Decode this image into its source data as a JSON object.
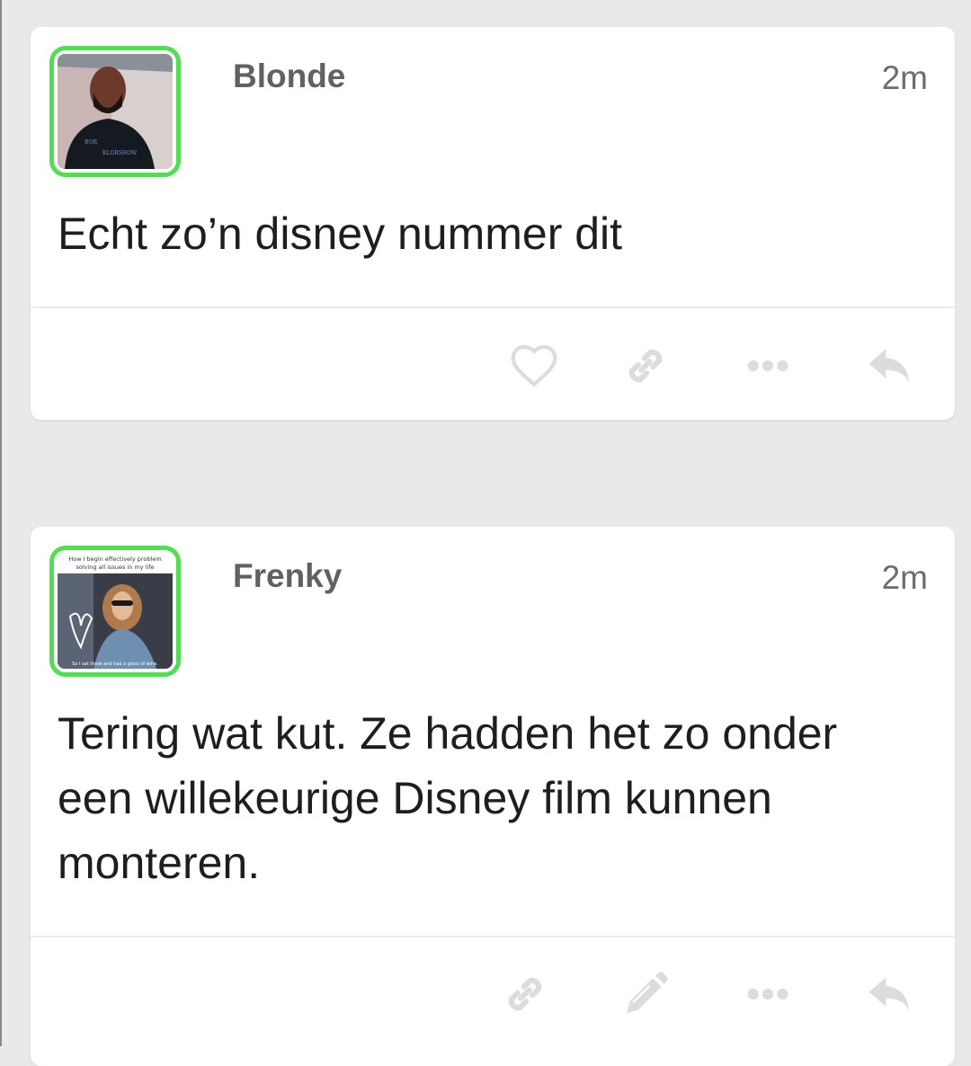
{
  "posts": [
    {
      "username": "Blonde",
      "time": "2m",
      "text": "Echt zo’n disney nummer dit",
      "avatar_text": [
        "BOR",
        "KLORSHOW"
      ],
      "actions": [
        "heart-icon",
        "link-icon",
        "more-icon",
        "reply-icon"
      ]
    },
    {
      "username": "Frenky",
      "time": "2m",
      "text": "Tering wat kut. Ze hadden het zo onder een willekeurige Disney film kunnen monteren.",
      "avatar_text": [
        "How I begin effectively problem",
        "solving all issues in my life",
        "So I sat there and had a glass of wine."
      ],
      "actions": [
        "link-icon",
        "pencil-icon",
        "more-icon",
        "reply-icon"
      ]
    }
  ],
  "colors": {
    "background": "#e9e9e9",
    "card": "#ffffff",
    "avatar_border": "#4ee04e",
    "icon": "#dcdcdc",
    "username": "#616161",
    "text": "#1e1e1e"
  }
}
